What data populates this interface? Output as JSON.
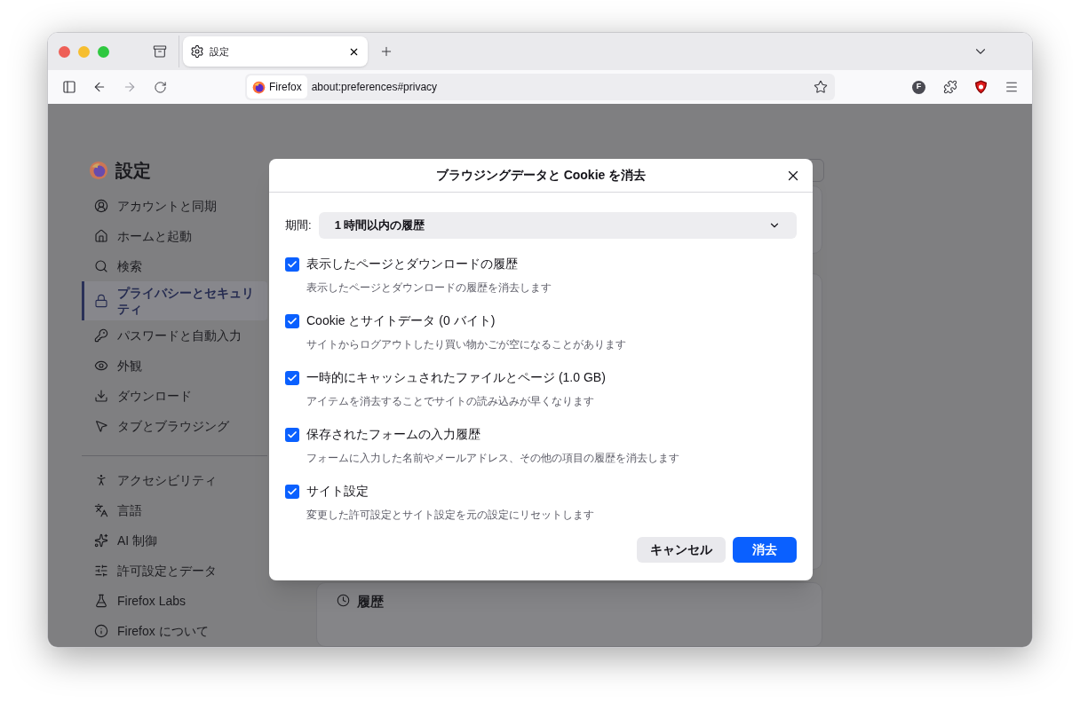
{
  "tab": {
    "title": "設定"
  },
  "url_bar": {
    "identity": "Firefox",
    "url": "about:preferences#privacy"
  },
  "account_badge": "F",
  "sidebar": {
    "title": "設定",
    "groups": [
      [
        {
          "label": "アカウントと同期",
          "selected": false
        },
        {
          "label": "ホームと起動",
          "selected": false
        },
        {
          "label": "検索",
          "selected": false
        },
        {
          "label": "プライバシーとセキュリティ",
          "selected": true
        },
        {
          "label": "パスワードと自動入力",
          "selected": false
        },
        {
          "label": "外観",
          "selected": false
        },
        {
          "label": "ダウンロード",
          "selected": false
        },
        {
          "label": "タブとブラウジング",
          "selected": false
        }
      ],
      [
        {
          "label": "アクセシビリティ",
          "selected": false
        },
        {
          "label": "言語",
          "selected": false
        },
        {
          "label": "AI 制御",
          "selected": false
        },
        {
          "label": "許可設定とデータ",
          "selected": false
        },
        {
          "label": "Firefox Labs",
          "selected": false
        },
        {
          "label": "Firefox について",
          "selected": false
        }
      ]
    ]
  },
  "background_card": {
    "heading": "履歴"
  },
  "dialog": {
    "title": "ブラウジングデータと Cookie を消去",
    "period_label": "期間:",
    "period_value": "1 時間以内の履歴",
    "options": [
      {
        "label": "表示したページとダウンロードの履歴",
        "description": "表示したページとダウンロードの履歴を消去します",
        "checked": true
      },
      {
        "label": "Cookie とサイトデータ (0 バイト)",
        "description": "サイトからログアウトしたり買い物かごが空になることがあります",
        "checked": true
      },
      {
        "label": "一時的にキャッシュされたファイルとページ (1.0 GB)",
        "description": "アイテムを消去することでサイトの読み込みが早くなります",
        "checked": true
      },
      {
        "label": "保存されたフォームの入力履歴",
        "description": "フォームに入力した名前やメールアドレス、その他の項目の履歴を消去します",
        "checked": true
      },
      {
        "label": "サイト設定",
        "description": "変更した許可設定とサイト設定を元の設定にリセットします",
        "checked": true
      }
    ],
    "cancel_button": "キャンセル",
    "confirm_button": "消去"
  }
}
